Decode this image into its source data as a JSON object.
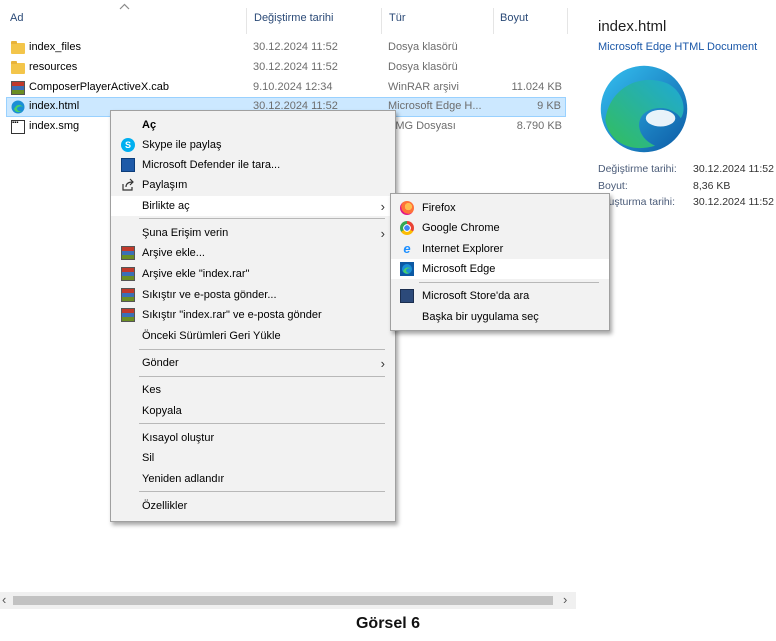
{
  "columns": {
    "name": "Ad",
    "date": "Değiştirme tarihi",
    "type": "Tür",
    "size": "Boyut"
  },
  "files": [
    {
      "name": "index_files",
      "date": "30.12.2024 11:52",
      "type": "Dosya klasörü",
      "size": "",
      "icon": "folder-icon"
    },
    {
      "name": "resources",
      "date": "30.12.2024 11:52",
      "type": "Dosya klasörü",
      "size": "",
      "icon": "folder-icon"
    },
    {
      "name": "ComposerPlayerActiveX.cab",
      "date": "9.10.2024 12:34",
      "type": "WinRAR arşivi",
      "size": "11.024 KB",
      "icon": "winrar-icon"
    },
    {
      "name": "index.html",
      "date": "30.12.2024 11:52",
      "type": "Microsoft Edge H...",
      "size": "9 KB",
      "icon": "edge-icon"
    },
    {
      "name": "index.smg",
      "date": "",
      "type": "SMG Dosyası",
      "size": "8.790 KB",
      "icon": "smg-file-icon"
    }
  ],
  "context_menu": {
    "open": "Aç",
    "skype": "Skype ile paylaş",
    "defender": "Microsoft Defender ile tara...",
    "share": "Paylaşım",
    "open_with": "Birlikte aç",
    "grant_access": "Şuna Erişim verin",
    "add_archive": "Arşive ekle...",
    "add_index_rar": "Arşive ekle \"index.rar\"",
    "compress_email": "Sıkıştır ve e-posta gönder...",
    "compress_index_email": "Sıkıştır \"index.rar\" ve e-posta gönder",
    "restore": "Önceki Sürümleri Geri Yükle",
    "send_to": "Gönder",
    "cut": "Kes",
    "copy": "Kopyala",
    "shortcut": "Kısayol oluştur",
    "delete": "Sil",
    "rename": "Yeniden adlandır",
    "properties": "Özellikler"
  },
  "submenu": {
    "firefox": "Firefox",
    "chrome": "Google Chrome",
    "ie": "Internet Explorer",
    "edge": "Microsoft Edge",
    "store": "Microsoft Store'da ara",
    "other": "Başka bir uygulama seç"
  },
  "details": {
    "title": "index.html",
    "subtitle": "Microsoft Edge HTML Document",
    "modified_label": "Değiştirme tarihi:",
    "modified_value": "30.12.2024 11:52",
    "size_label": "Boyut:",
    "size_value": "8,36 KB",
    "created_label": "Oluşturma tarihi:",
    "created_value": "30.12.2024 11:52"
  },
  "scrollbar": {
    "left_arrow": "‹",
    "right_arrow": "›"
  },
  "caption": "Görsel 6",
  "colors": {
    "selection": "#cce8ff",
    "menu_bg": "#f2f2f2",
    "link_blue": "#1a57a8"
  }
}
